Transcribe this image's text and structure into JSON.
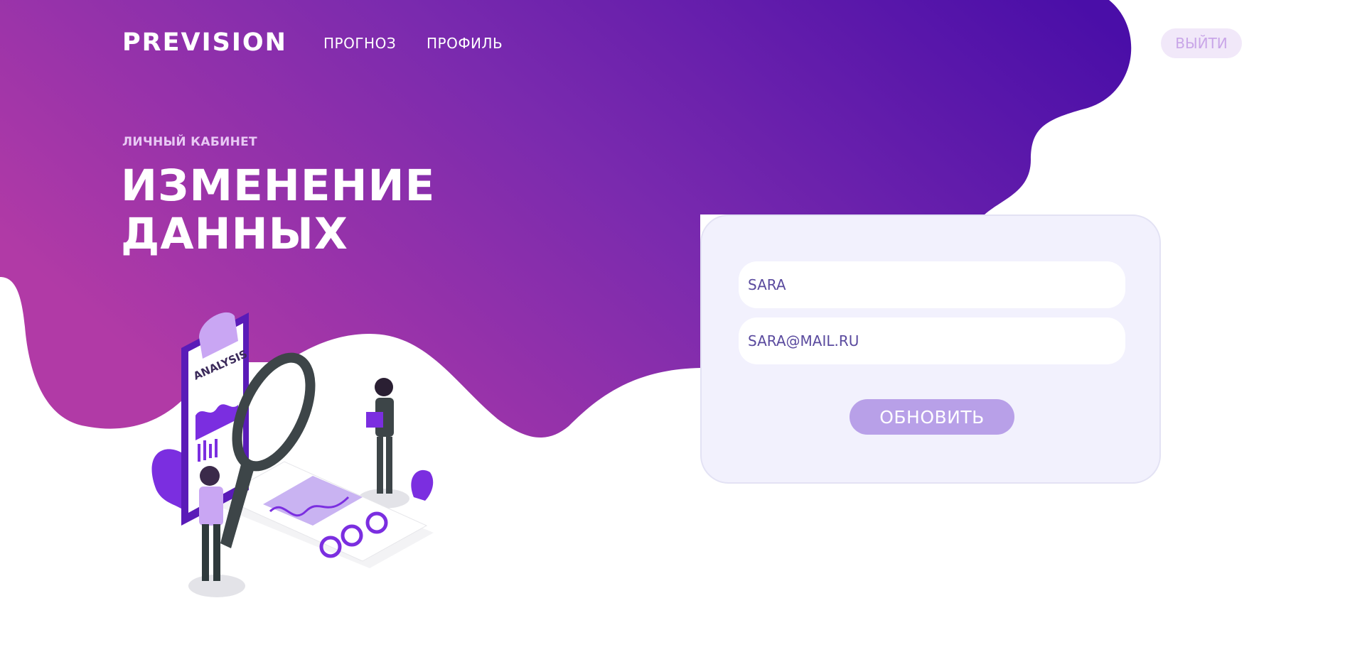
{
  "header": {
    "logo": "PREVISION",
    "nav": [
      {
        "label": "ПРОГНОЗ"
      },
      {
        "label": "ПРОФИЛЬ"
      }
    ],
    "logout_label": "ВЫЙТИ"
  },
  "hero": {
    "eyebrow": "ЛИЧНЫЙ КАБИНЕТ",
    "title_line1": "ИЗМЕНЕНИЕ",
    "title_line2": "ДАННЫХ"
  },
  "form": {
    "name_value": "SARA",
    "email_value": "SARA@MAIL.RU",
    "submit_label": "ОБНОВИТЬ"
  },
  "illustration": {
    "board_label": "ANALYSIS"
  },
  "colors": {
    "gradient_start": "#b13aa6",
    "gradient_end": "#4b0ea8",
    "card_bg": "#f2f1fd",
    "button_bg": "#b8a0e8",
    "logout_bg": "#f1e8f9",
    "logout_text": "#c9a6e8",
    "accent_purple": "#7b2ee0"
  }
}
